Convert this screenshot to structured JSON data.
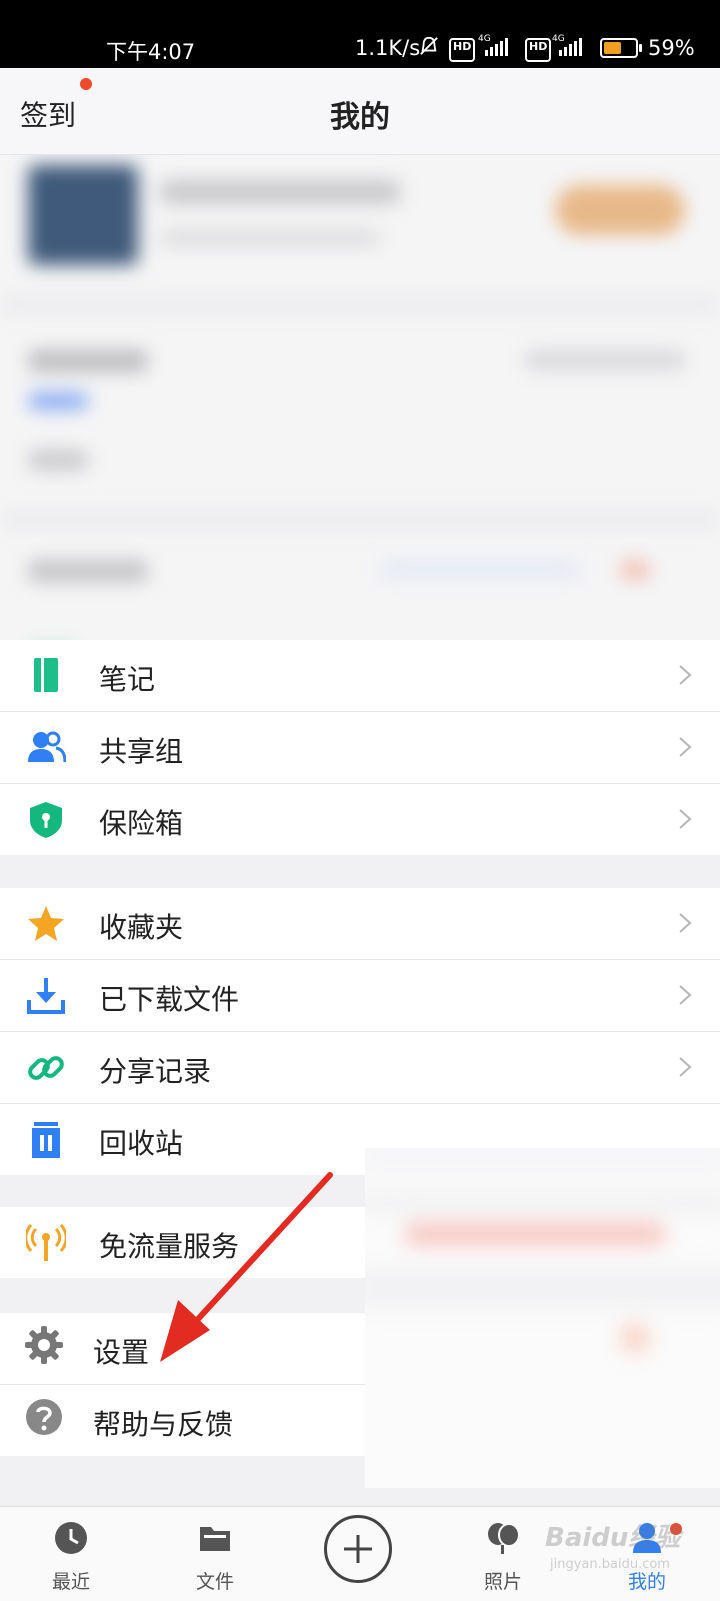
{
  "status_bar": {
    "time": "下午4:07",
    "net_rate": "1.1K/s",
    "battery": "59%",
    "network_badges": [
      "HD",
      "4G",
      "HD",
      "4G"
    ],
    "icons": [
      "bell-muted-icon",
      "signal-icon",
      "signal-icon",
      "battery-icon"
    ]
  },
  "header": {
    "signin_label": "签到",
    "title": "我的"
  },
  "menu": {
    "group1": [
      {
        "label": "笔记",
        "icon": "note-icon",
        "color": "#1bbf87"
      },
      {
        "label": "共享组",
        "icon": "users-icon",
        "color": "#2f7ff5"
      },
      {
        "label": "保险箱",
        "icon": "shield-lock-icon",
        "color": "#14b87e"
      }
    ],
    "group2": [
      {
        "label": "收藏夹",
        "icon": "star-icon",
        "color": "#f5a524"
      },
      {
        "label": "已下载文件",
        "icon": "download-icon",
        "color": "#2f7ff5"
      },
      {
        "label": "分享记录",
        "icon": "link-icon",
        "color": "#14b87e"
      },
      {
        "label": "回收站",
        "icon": "trash-icon",
        "color": "#2f7ff5"
      }
    ],
    "group3": [
      {
        "label": "免流量服务",
        "icon": "antenna-icon",
        "color": "#f5a524"
      }
    ],
    "group4": [
      {
        "label": "设置",
        "icon": "gear-icon",
        "color": "#777777"
      },
      {
        "label": "帮助与反馈",
        "icon": "help-icon",
        "color": "#888888"
      }
    ]
  },
  "bottom_nav": {
    "items": [
      {
        "label": "最近",
        "icon": "clock-icon"
      },
      {
        "label": "文件",
        "icon": "folder-icon"
      },
      {
        "label": "照片",
        "icon": "photos-icon"
      },
      {
        "label": "我的",
        "icon": "profile-icon"
      }
    ],
    "add_icon": "plus-circle-icon",
    "active_color": "#2f7ff5"
  },
  "watermark": {
    "text": "Baidu经验",
    "sub": "jingyan.baidu.com"
  }
}
